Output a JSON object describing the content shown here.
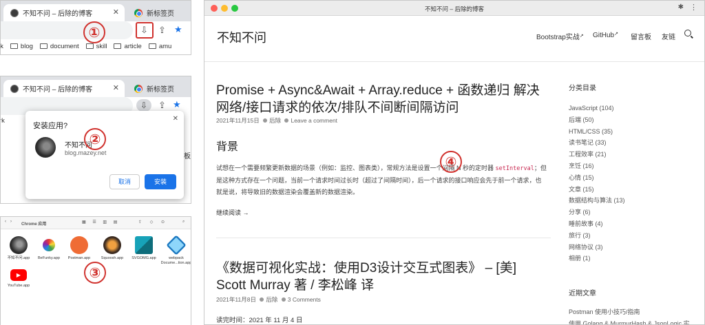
{
  "panel1": {
    "tabs": [
      {
        "label": "不知不问 – 后除的博客",
        "close": "✕"
      },
      {
        "label": "新标签页"
      }
    ],
    "bookmarks": [
      "rk",
      "blog",
      "document",
      "skill",
      "article",
      "amu"
    ],
    "callout": "①"
  },
  "panel2": {
    "tabs": [
      {
        "label": "不知不问 – 后除的博客",
        "close": "✕"
      },
      {
        "label": "新标签页"
      }
    ],
    "bookmark_fragment": "rk",
    "dialog": {
      "title": "安装应用?",
      "close": "✕",
      "app_name": "不知不问",
      "app_domain": "blog.mazey.net",
      "cancel": "取消",
      "install": "安装"
    },
    "side_fragment": "板",
    "callout": "②"
  },
  "panel3": {
    "title": "Chrome 应用",
    "apps": [
      {
        "label": "不知不问.app",
        "color": "#3a3a3a"
      },
      {
        "label": "BeFunky.app",
        "color": "#ffffff"
      },
      {
        "label": "Postman.app",
        "color": "#ef6c35"
      },
      {
        "label": "Squoosh.app",
        "color": "#3a2a20"
      },
      {
        "label": "SVGOMG.app",
        "color": "#17a2b8"
      },
      {
        "label": "webpack Docume...tion.app",
        "color": "#8ed6fb"
      },
      {
        "label": "YouTube.app",
        "color": "#ff0000"
      }
    ],
    "callout": "③"
  },
  "browser": {
    "window_title": "不知不问 – 后除的博客",
    "site_title": "不知不问",
    "nav": [
      {
        "label": "Bootstrap实战",
        "ext": "↗"
      },
      {
        "label": "GitHub",
        "ext": "↗"
      },
      {
        "label": "留言板"
      },
      {
        "label": "友链"
      }
    ],
    "posts": [
      {
        "title": "Promise + Async&Await + Array.reduce + 函数递归 解决网络/接口请求的依次/排队不间断间隔访问",
        "date": "2021年11月15日",
        "author": "后除",
        "comments": "Leave a comment",
        "section_heading": "背景",
        "para_a": "试想在一个需要频繁更新数据的场景（例如：监控、图表类），常规方法是设置一个间隔 N 秒的定时器",
        "code": "setInterval",
        "para_b": "；但是这种方式存在一个问题，当前一个请求时间过长时（超过了间隔时间），后一个请求的接口响应会先于前一个请求，也就是说，将导致旧的数据渲染会覆盖新的数据渲染。",
        "read_more": "继续阅读 →"
      },
      {
        "title": "《数据可视化实战：使用D3设计交互式图表》 – [美] Scott Murray 著 / 李松峰 译",
        "date": "2021年11月8日",
        "author": "后除",
        "comments": "3 Comments",
        "read_time": "读完时间：2021 年 11 月 4 日"
      }
    ],
    "categories_heading": "分类目录",
    "categories": [
      "JavaScript (104)",
      "后端 (50)",
      "HTML/CSS (35)",
      "读书笔记 (33)",
      "工程效率 (21)",
      "烹饪 (16)",
      "心情 (15)",
      "文章 (15)",
      "数据结构与算法 (13)",
      "分享 (6)",
      "睡前故事 (4)",
      "旅行 (3)",
      "网络协议 (3)",
      "相册 (1)"
    ],
    "recent_heading": "近期文章",
    "recent": [
      "Postman 使用小技巧/指南",
      "使用 Golang & MurmurHash & JsonLogic 实"
    ],
    "callout": "④"
  },
  "colors": {
    "accent": "#1a73e8",
    "callout": "#d0312d"
  }
}
